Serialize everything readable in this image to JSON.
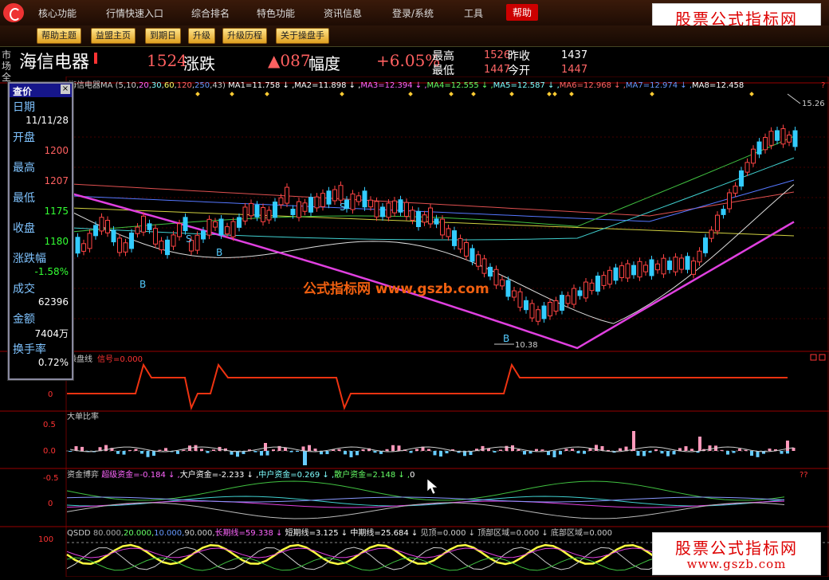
{
  "menu": [
    "核心功能",
    "行情快速入口",
    "综合排名",
    "特色功能",
    "资讯信息",
    "登录/系统",
    "工具",
    "帮助"
  ],
  "toolbar": [
    "帮助主题",
    "益盟主页",
    "到期日",
    "升级",
    "升级历程",
    "关于操盘手"
  ],
  "watermark": {
    "line1": "股票公式指标网",
    "line2": "www.gszb.com"
  },
  "quote": {
    "side_label": "市场全",
    "name": "海信电器",
    "price": "1524",
    "price_label": "涨跌",
    "change": "▲087",
    "change_label": "幅度",
    "pct": "+6.05%",
    "high_label": "最高",
    "high": "1526",
    "low_label": "最低",
    "low": "1447",
    "prev_label": "昨收",
    "prev": "1437",
    "open_label": "今开",
    "open": "1447"
  },
  "main_chart": {
    "legend": [
      {
        "text": "海信电器",
        "color": "#cccccc"
      },
      {
        "text": "MA (5,10,",
        "color": "#cccccc"
      },
      {
        "text": "20",
        "color": "#ff66ff"
      },
      {
        "text": ",",
        "color": "#cccccc"
      },
      {
        "text": "30",
        "color": "#7fffff"
      },
      {
        "text": ",",
        "color": "#cccccc"
      },
      {
        "text": "60",
        "color": "#ffff66"
      },
      {
        "text": ",",
        "color": "#cccccc"
      },
      {
        "text": "120",
        "color": "#ff6666"
      },
      {
        "text": ",",
        "color": "#cccccc"
      },
      {
        "text": "250",
        "color": "#6699ff"
      },
      {
        "text": ",43)",
        "color": "#cccccc"
      }
    ],
    "ma_values": [
      {
        "text": "MA1=11.758",
        "color": "#ffffff"
      },
      {
        "text": "MA2=11.898",
        "color": "#ffffff"
      },
      {
        "text": "MA3=12.394",
        "color": "#ff66ff"
      },
      {
        "text": "MA4=12.555",
        "color": "#66ff66"
      },
      {
        "text": "MA5=12.587",
        "color": "#7fffff"
      },
      {
        "text": "MA6=12.968",
        "color": "#ff6666"
      },
      {
        "text": "MA7=12.974",
        "color": "#6699ff"
      },
      {
        "text": "MA8=12.458",
        "color": "#ffffff"
      }
    ],
    "price_high_label": "15.26",
    "price_low_label": "10.38",
    "watermark": "公式指标网 www.gszb.com",
    "signals": {
      "buy": "B",
      "sell": "S"
    }
  },
  "query_panel": {
    "title": "查价",
    "rows": [
      {
        "label": "日期",
        "value": "11/11/28",
        "color": "#ffffff"
      },
      {
        "label": "开盘",
        "value": "1200",
        "color": "#ff6060"
      },
      {
        "label": "最高",
        "value": "1207",
        "color": "#ff6060"
      },
      {
        "label": "最低",
        "value": "1175",
        "color": "#33ff33"
      },
      {
        "label": "收盘",
        "value": "1180",
        "color": "#33ff33"
      },
      {
        "label": "涨跌幅",
        "value": "-1.58%",
        "color": "#33ff33"
      },
      {
        "label": "成交",
        "value": "62396",
        "color": "#ffffff"
      },
      {
        "label": "金额",
        "value": "7404万",
        "color": "#ffffff"
      },
      {
        "label": "换手率",
        "value": "0.72%",
        "color": "#ffffff"
      }
    ]
  },
  "sub1": {
    "title": "操盘线",
    "signal": "信号=0.000",
    "zero": "0"
  },
  "sub2": {
    "title": "大单比率",
    "y0": "0.5",
    "y1": "0.0",
    "y2": "-0.5"
  },
  "sub3": {
    "title": "资金博弈",
    "items": [
      {
        "text": "超级资金=-0.184",
        "color": "#ff66ff"
      },
      {
        "text": "大户资金=-2.233",
        "color": "#ffffff"
      },
      {
        "text": "中户资金=0.269",
        "color": "#7fffff"
      },
      {
        "text": "散户资金=2.148",
        "color": "#66ff66"
      },
      {
        "text": "0",
        "color": "#ffffff"
      }
    ],
    "zero": "0"
  },
  "sub4": {
    "title": "QSDD",
    "items": [
      {
        "text": "80.000",
        "color": "#aaaaaa"
      },
      {
        "text": "20.000",
        "color": "#66ff66"
      },
      {
        "text": "10.000",
        "color": "#6699ff"
      },
      {
        "text": "90.000",
        "color": "#cccccc"
      },
      {
        "text": "长期线=59.338",
        "color": "#ff66ff"
      },
      {
        "text": "短期线=3.125",
        "color": "#ffffff"
      },
      {
        "text": "中期线=25.684",
        "color": "#ffffff"
      },
      {
        "text": "见顶=0.000",
        "color": "#cccccc"
      },
      {
        "text": "顶部区域=0.000",
        "color": "#cccccc"
      },
      {
        "text": "底部区域=0.000",
        "color": "#cccccc"
      }
    ],
    "y100": "100"
  }
}
